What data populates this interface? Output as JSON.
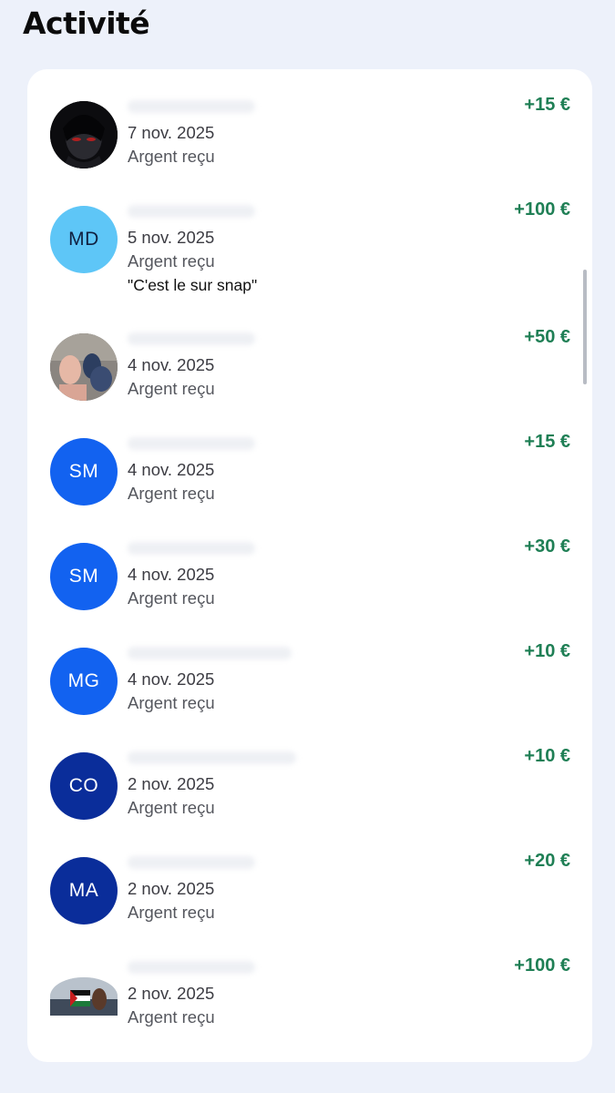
{
  "page": {
    "title": "Activité"
  },
  "transactions": [
    {
      "avatar": {
        "type": "photo",
        "icon": "dark-portrait-photo"
      },
      "date": "7 nov. 2025",
      "kind": "Argent reçu",
      "amount": "+15 €"
    },
    {
      "avatar": {
        "type": "initials",
        "initials": "MD",
        "color": "#5ec6f7"
      },
      "date": "5 nov. 2025",
      "kind": "Argent reçu",
      "note": "\"C'est le       sur snap\"",
      "amount": "+100 €"
    },
    {
      "avatar": {
        "type": "photo",
        "icon": "hands-photo"
      },
      "date": "4 nov. 2025",
      "kind": "Argent reçu",
      "amount": "+50 €"
    },
    {
      "avatar": {
        "type": "initials",
        "initials": "SM",
        "color": "#1262f0"
      },
      "date": "4 nov. 2025",
      "kind": "Argent reçu",
      "amount": "+15 €"
    },
    {
      "avatar": {
        "type": "initials",
        "initials": "SM",
        "color": "#1262f0"
      },
      "date": "4 nov. 2025",
      "kind": "Argent reçu",
      "amount": "+30 €"
    },
    {
      "avatar": {
        "type": "initials",
        "initials": "MG",
        "color": "#1262f0"
      },
      "date": "4 nov. 2025",
      "kind": "Argent reçu",
      "amount": "+10 €"
    },
    {
      "avatar": {
        "type": "initials",
        "initials": "CO",
        "color": "#0a2d9a"
      },
      "date": "2 nov. 2025",
      "kind": "Argent reçu",
      "amount": "+10 €"
    },
    {
      "avatar": {
        "type": "initials",
        "initials": "MA",
        "color": "#0a2d9a"
      },
      "date": "2 nov. 2025",
      "kind": "Argent reçu",
      "amount": "+20 €"
    },
    {
      "avatar": {
        "type": "photo",
        "icon": "flag-photo"
      },
      "date": "2 nov. 2025",
      "kind": "Argent reçu",
      "amount": "+100 €"
    }
  ]
}
